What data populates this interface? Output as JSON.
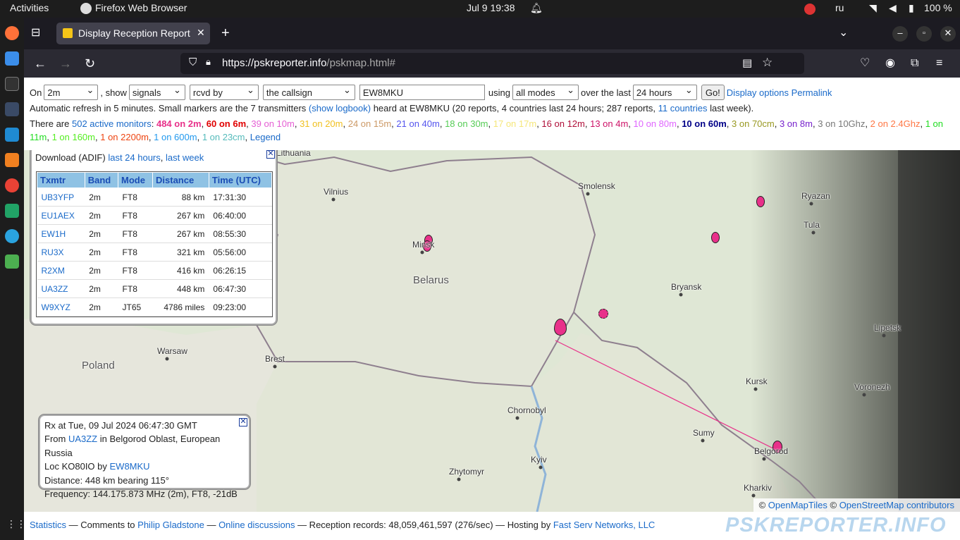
{
  "topbar": {
    "activities": "Activities",
    "app": "Firefox Web Browser",
    "datetime": "Jul 9  19:38",
    "lang": "ru",
    "battery": "100 %"
  },
  "browser": {
    "tab_title": "Display Reception Report",
    "url_host": "https://pskreporter.info",
    "url_path": "/pskmap.html#"
  },
  "controls": {
    "on_label": "On",
    "band": "2m",
    "show_label": ", show",
    "what": "signals",
    "rcvd": "rcvd by",
    "callsign_sel": "the callsign",
    "callsign": "EW8MKU",
    "using_label": "using",
    "modes": "all modes",
    "over_label": "over the last",
    "period": "24 hours",
    "go": "Go!",
    "display_options": "Display options",
    "permalink": "Permalink"
  },
  "status": {
    "text1": "Automatic refresh in 5 minutes. Small markers are the 7 transmitters ",
    "show_logbook": "(show logbook)",
    "text2": " heard at EW8MKU (20 reports, 4 countries last 24 hours; 287 reports, ",
    "countries_link": "11 countries",
    "text3": " last week)."
  },
  "monitors": {
    "prefix": "There are ",
    "active_link": "502 active monitors",
    "colon": ":",
    "bands": [
      {
        "text": "484 on 2m",
        "color": "#e8318a",
        "bold": true
      },
      {
        "text": "60 on 6m",
        "color": "#e00000",
        "bold": true
      },
      {
        "text": "39 on 10m",
        "color": "#e55fd4",
        "bold": false
      },
      {
        "text": "31 on 20m",
        "color": "#f0c020",
        "bold": false
      },
      {
        "text": "24 on 15m",
        "color": "#cc9966",
        "bold": false
      },
      {
        "text": "21 on 40m",
        "color": "#5555ee",
        "bold": false
      },
      {
        "text": "18 on 30m",
        "color": "#55cc55",
        "bold": false
      },
      {
        "text": "17 on 17m",
        "color": "#f5e77a",
        "bold": false
      },
      {
        "text": "16 on 12m",
        "color": "#b0103a",
        "bold": false
      },
      {
        "text": "13 on 4m",
        "color": "#cc1166",
        "bold": false
      },
      {
        "text": "10 on 80m",
        "color": "#e066ff",
        "bold": false
      },
      {
        "text": "10 on 60m",
        "color": "#000088",
        "bold": true
      },
      {
        "text": "3 on 70cm",
        "color": "#999922",
        "bold": false
      },
      {
        "text": "3 on 8m",
        "color": "#7722cc",
        "bold": false
      },
      {
        "text": "3 on 10Ghz",
        "color": "#777777",
        "bold": false
      },
      {
        "text": "2 on 2.4Ghz",
        "color": "#ff7744",
        "bold": false
      },
      {
        "text": "1 on 11m",
        "color": "#22dd22",
        "bold": false
      },
      {
        "text": "1 on 160m",
        "color": "#55ee22",
        "bold": false
      },
      {
        "text": "1 on 2200m",
        "color": "#ee4411",
        "bold": false
      },
      {
        "text": "1 on 600m",
        "color": "#2299ee",
        "bold": false
      },
      {
        "text": "1 on 23cm",
        "color": "#55bbbb",
        "bold": false
      }
    ],
    "legend": "Legend"
  },
  "report_popup": {
    "download_label": "Download (ADIF)",
    "last24": "last 24 hours",
    "lastweek": "last week",
    "headers": [
      "Txmtr",
      "Band",
      "Mode",
      "Distance",
      "Time (UTC)"
    ],
    "rows": [
      {
        "call": "UB3YFP",
        "band": "2m",
        "mode": "FT8",
        "dist": "88 km",
        "time": "17:31:30"
      },
      {
        "call": "EU1AEX",
        "band": "2m",
        "mode": "FT8",
        "dist": "267 km",
        "time": "06:40:00"
      },
      {
        "call": "EW1H",
        "band": "2m",
        "mode": "FT8",
        "dist": "267 km",
        "time": "08:55:30"
      },
      {
        "call": "RU3X",
        "band": "2m",
        "mode": "FT8",
        "dist": "321 km",
        "time": "05:56:00"
      },
      {
        "call": "R2XM",
        "band": "2m",
        "mode": "FT8",
        "dist": "416 km",
        "time": "06:26:15"
      },
      {
        "call": "UA3ZZ",
        "band": "2m",
        "mode": "FT8",
        "dist": "448 km",
        "time": "06:47:30"
      },
      {
        "call": "W9XYZ",
        "band": "2m",
        "mode": "JT65",
        "dist": "4786 miles",
        "time": "09:23:00"
      }
    ]
  },
  "info_popup": {
    "line1": "Rx at Tue, 09 Jul 2024 06:47:30 GMT",
    "from_label": "From ",
    "from_call": "UA3ZZ",
    "from_rest": " in Belgorod Oblast, European Russia",
    "loc_label": "Loc KO80IO by ",
    "loc_call": "EW8MKU",
    "distance": "Distance: 448 km bearing 115°",
    "frequency": "Frequency: 144.175.873 MHz (2m), FT8, -21dB"
  },
  "map": {
    "cities": [
      "Vilnius",
      "Smolensk",
      "Ryazan",
      "Tula",
      "Minsk",
      "Belarus",
      "Bryansk",
      "Lipetsk",
      "Warsaw",
      "Brest",
      "Poland",
      "Kursk",
      "Voronezh",
      "Chornobyl",
      "Sumy",
      "Belgorod",
      "Kyiv",
      "Zhytomyr",
      "Kharkiv",
      "Lithuania"
    ],
    "attribution_c1": "©",
    "attribution_tiles": "OpenMapTiles",
    "attribution_c2": "©",
    "attribution_osm": "OpenStreetMap contributors",
    "path_color": "#e8318a"
  },
  "footer": {
    "statistics": "Statistics",
    "comments": " — Comments to ",
    "author": "Philip Gladstone",
    "dash1": " — ",
    "discussions": "Online discussions",
    "records": " — Reception records: 48,059,461,597 (276/sec) — Hosting by ",
    "host": "Fast Serv Networks, LLC",
    "logo": "PSKREPORTER.INFO"
  }
}
